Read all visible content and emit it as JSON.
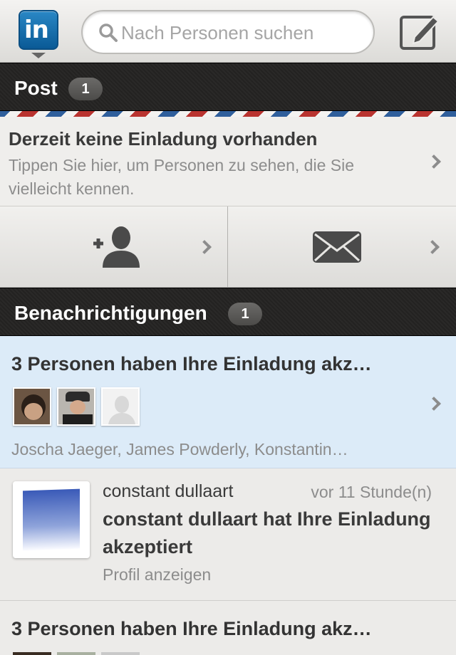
{
  "header": {
    "logo_text": "in",
    "search_placeholder": "Nach Personen suchen"
  },
  "post": {
    "title": "Post",
    "badge": "1",
    "invite_title": "Derzeit keine Einladung vorhanden",
    "invite_subtitle": "Tippen Sie hier, um Personen zu sehen, die Sie vielleicht kennen."
  },
  "notifications": {
    "title": "Benachrichtigungen",
    "badge": "1",
    "items": [
      {
        "title": "3 Personen haben Ihre Einladung akz…",
        "names": "Joscha Jaeger, James Powderly, Konstantin…"
      },
      {
        "name": "constant dullaart",
        "time": "vor 11 Stunde(n)",
        "message": "constant dullaart hat Ihre Einladung akzeptiert",
        "link": "Profil anzeigen"
      },
      {
        "title": "3 Personen haben Ihre Einladung akz…"
      }
    ]
  },
  "colors": {
    "brand_blue": "#0a66a8",
    "highlight": "#dcebf8"
  }
}
